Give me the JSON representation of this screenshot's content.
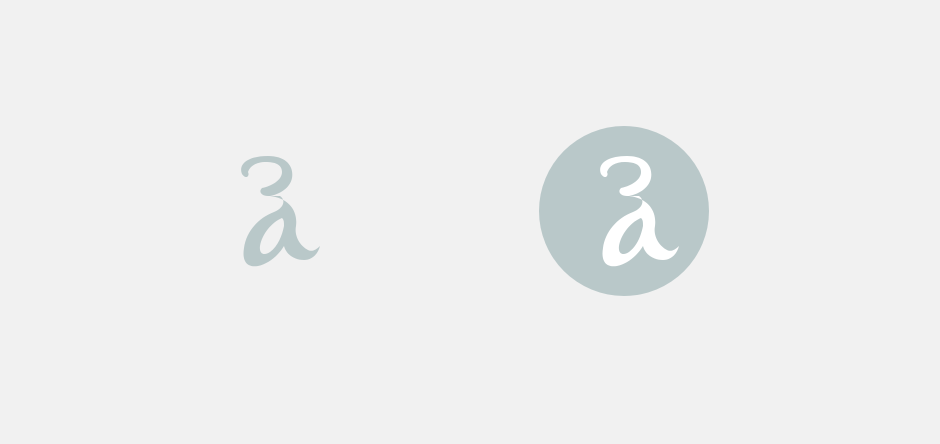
{
  "logos": {
    "plain": {
      "icon": "script-letter-logo-icon",
      "color": "#b9c8c9"
    },
    "badge": {
      "icon": "script-letter-logo-badge-icon",
      "badge_color": "#b9c8c9",
      "glyph_color": "#ffffff"
    }
  },
  "background_color": "#f1f1f1"
}
